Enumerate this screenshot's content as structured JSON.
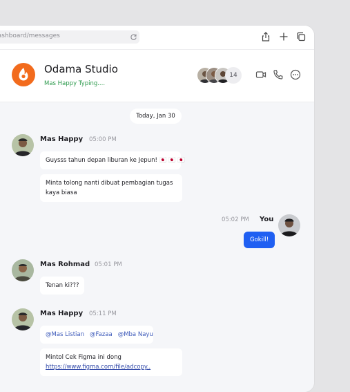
{
  "browser": {
    "url": "/dashboard/messages"
  },
  "header": {
    "title": "Odama Studio",
    "typing_status": "Mas Happy Typing....",
    "member_count": "14"
  },
  "chat": {
    "date_label": "Today, Jan 30",
    "messages": [
      {
        "sender": "Mas Happy",
        "time": "05:00 PM",
        "bubbles": [
          "Guysss tahun depan liburan ke Jepun! 🇯🇵 🇯🇵 🇯🇵",
          "Minta tolong nanti dibuat pembagian tugas kaya biasa"
        ]
      },
      {
        "sender": "You",
        "time": "05:02 PM",
        "bubbles": [
          "Gokill!"
        ]
      },
      {
        "sender": "Mas Rohmad",
        "time": "05:01 PM",
        "bubbles": [
          "Tenan ki???"
        ]
      },
      {
        "sender": "Mas Happy",
        "time": "05:11 PM",
        "mentions": [
          "@Mas Listian",
          "@Fazaa",
          "@Mba Nayu"
        ],
        "bubbles": [
          "Mintol Cek Figma ini dong"
        ],
        "link": "https://www.figma.com/file/adcopy.."
      }
    ]
  },
  "icons": {
    "share": "share-icon",
    "new_tab": "plus-icon",
    "tabs": "copy-icon",
    "video": "video-camera-icon",
    "phone": "phone-icon",
    "more": "more-options-icon"
  },
  "colors": {
    "accent": "#1f5ff2",
    "logo": "#f26b1d",
    "typing": "#2c9a4c"
  }
}
